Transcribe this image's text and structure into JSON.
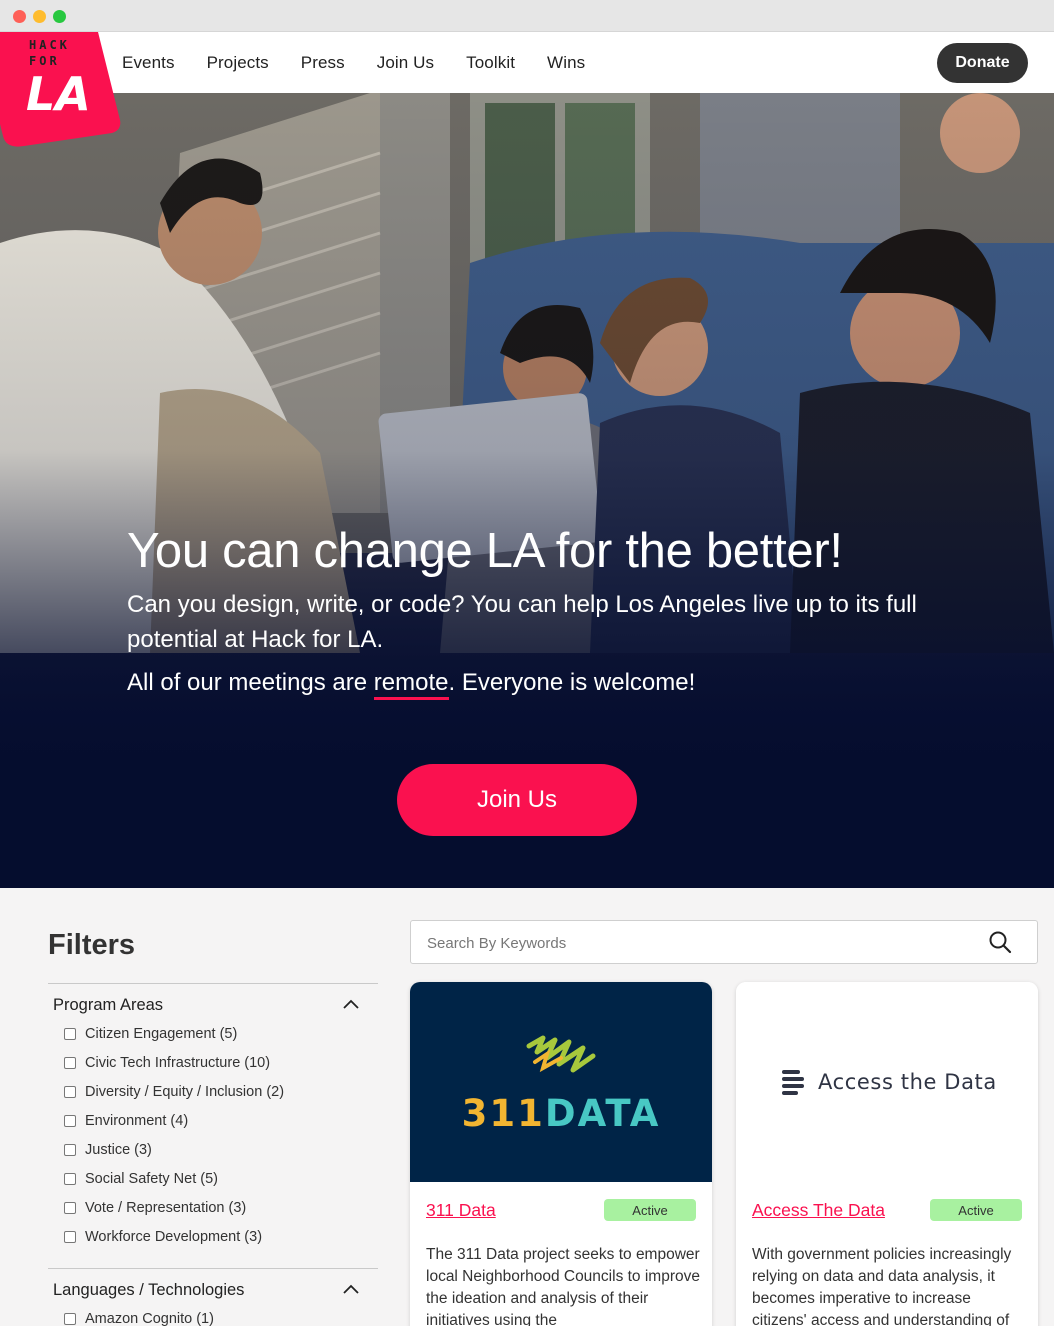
{
  "window": {
    "controls": [
      "close",
      "minimize",
      "maximize"
    ]
  },
  "logo": {
    "alt": "Hack for LA",
    "line1": "HACK",
    "line2": "FOR",
    "line3": "LA",
    "color": "#fa114f"
  },
  "nav": {
    "items": [
      {
        "label": "Events"
      },
      {
        "label": "Projects"
      },
      {
        "label": "Press"
      },
      {
        "label": "Join Us"
      },
      {
        "label": "Toolkit"
      },
      {
        "label": "Wins"
      }
    ],
    "donate_label": "Donate"
  },
  "hero": {
    "title": "You can change LA for the better!",
    "subtitle": "Can you design, write, or code? You can help Los Angeles live up to its full potential at Hack for LA.",
    "meetings_prefix": "All of our meetings are ",
    "meetings_link": "remote",
    "meetings_suffix": ". Everyone is welcome!",
    "cta_label": "Join Us"
  },
  "filters": {
    "title": "Filters",
    "groups": [
      {
        "label": "Program Areas",
        "expanded": true,
        "options": [
          {
            "label": "Citizen Engagement (5)",
            "checked": false
          },
          {
            "label": "Civic Tech Infrastructure (10)",
            "checked": false
          },
          {
            "label": "Diversity / Equity / Inclusion (2)",
            "checked": false
          },
          {
            "label": "Environment (4)",
            "checked": false
          },
          {
            "label": "Justice (3)",
            "checked": false
          },
          {
            "label": "Social Safety Net (5)",
            "checked": false
          },
          {
            "label": "Vote / Representation (3)",
            "checked": false
          },
          {
            "label": "Workforce Development (3)",
            "checked": false
          }
        ]
      },
      {
        "label": "Languages / Technologies",
        "expanded": true,
        "options": [
          {
            "label": "Amazon Cognito (1)",
            "checked": false
          }
        ]
      }
    ]
  },
  "search": {
    "placeholder": "Search By Keywords",
    "value": ""
  },
  "projects": [
    {
      "title": "311 Data",
      "status": "Active",
      "logo_num": "311",
      "logo_word": "DATA",
      "description": "The 311 Data project seeks to empower local Neighborhood Councils to improve the ideation and analysis of their initiatives using the"
    },
    {
      "title": "Access The Data",
      "status": "Active",
      "logo_text": "Access the Data",
      "description": "With government policies increasingly relying on data and data analysis, it becomes imperative to increase citizens' access and understanding of"
    }
  ],
  "colors": {
    "accent": "#fa114f",
    "navy": "#050d2e",
    "badge": "#a8f1a0",
    "donate": "#333333"
  }
}
